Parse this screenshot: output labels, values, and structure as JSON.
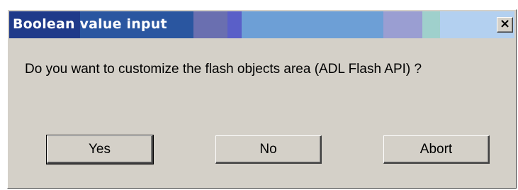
{
  "window": {
    "title": "Boolean value input",
    "close_glyph": "×",
    "close_icon": "close-icon"
  },
  "message": "Do you want to customize the flash objects area (ADL Flash API) ?",
  "buttons": {
    "yes": "Yes",
    "no": "No",
    "abort": "Abort"
  },
  "colors": {
    "dialog_face": "#d4d0c8",
    "titlebar_text": "#ffffff"
  }
}
